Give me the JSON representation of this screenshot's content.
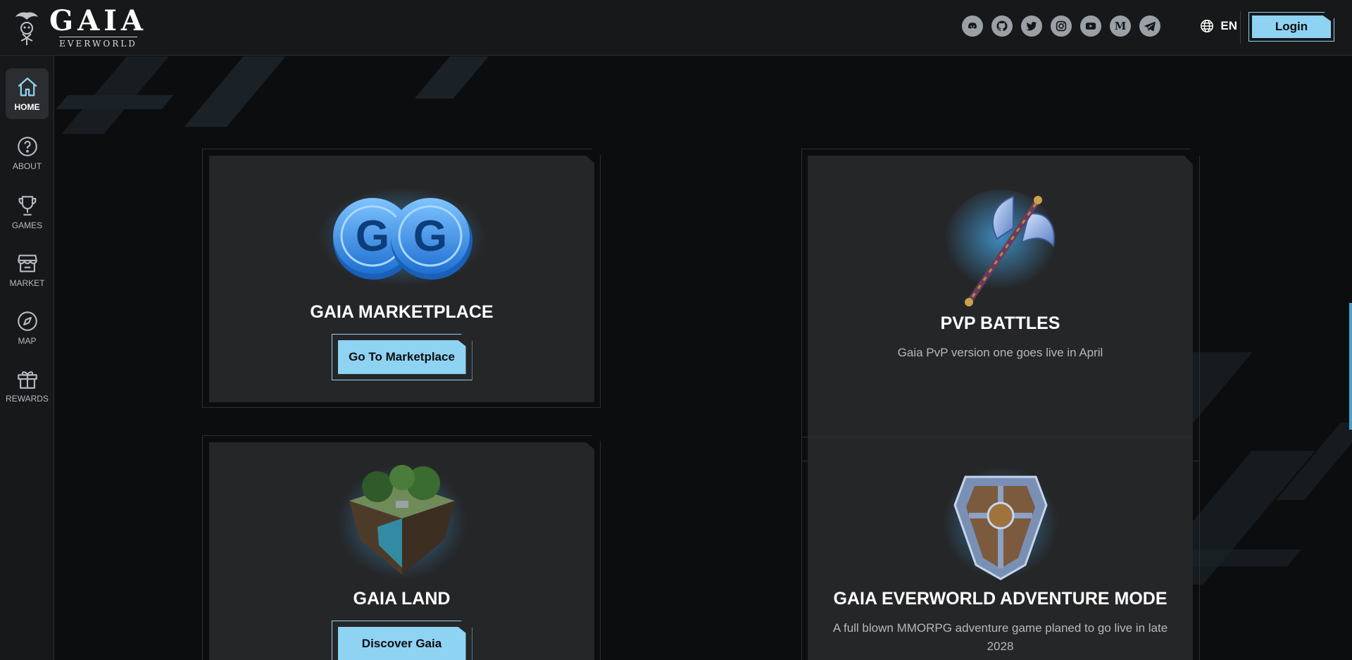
{
  "brand": {
    "name": "GAIA",
    "sub": "EVERWORLD"
  },
  "header": {
    "socials": [
      "discord-icon",
      "github-icon",
      "twitter-icon",
      "instagram-icon",
      "youtube-icon",
      "medium-icon",
      "telegram-icon"
    ],
    "medium_letter": "M",
    "lang": "EN",
    "login_label": "Login"
  },
  "sidebar": {
    "items": [
      {
        "label": "HOME",
        "icon": "home-icon"
      },
      {
        "label": "ABOUT",
        "icon": "question-icon"
      },
      {
        "label": "GAMES",
        "icon": "trophy-icon"
      },
      {
        "label": "MARKET",
        "icon": "store-icon"
      },
      {
        "label": "MAP",
        "icon": "compass-icon"
      },
      {
        "label": "REWARDS",
        "icon": "gift-icon"
      }
    ]
  },
  "cards": {
    "marketplace": {
      "title": "GAIA MARKETPLACE",
      "button": "Go To Marketplace",
      "image": "gaia-coins-image"
    },
    "pvp": {
      "title": "PVP BATTLES",
      "desc": "Gaia PvP version one goes live in April",
      "image": "battle-axe-image"
    },
    "land": {
      "title": "GAIA LAND",
      "button": "Discover Gaia",
      "image": "land-plot-image"
    },
    "adventure": {
      "title": "GAIA EVERWORLD ADVENTURE MODE",
      "desc": "A full blown MMORPG adventure game planed to go live in late 2028",
      "image": "shield-image"
    }
  },
  "colors": {
    "accent": "#8fd3f2",
    "card": "#252628",
    "background": "#0c0d0f",
    "panel": "#17181a"
  }
}
